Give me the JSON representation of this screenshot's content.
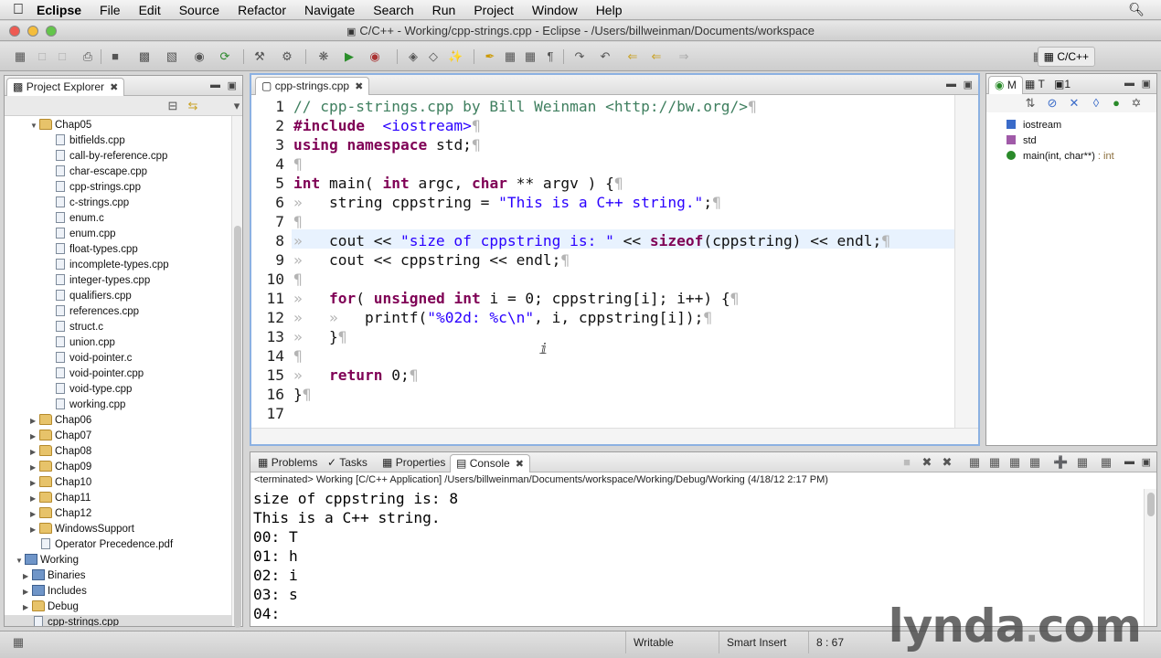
{
  "menubar": {
    "app": "Eclipse",
    "items": [
      "File",
      "Edit",
      "Source",
      "Refactor",
      "Navigate",
      "Search",
      "Run",
      "Project",
      "Window",
      "Help"
    ]
  },
  "window": {
    "title": "C/C++ - Working/cpp-strings.cpp - Eclipse - /Users/billweinman/Documents/workspace"
  },
  "toolbar": {
    "perspective": "C/C++"
  },
  "explorer": {
    "title": "Project Explorer",
    "tree": [
      {
        "label": "Chap05",
        "kind": "folder",
        "indent": 2,
        "expanded": true
      },
      {
        "label": "bitfields.cpp",
        "kind": "file",
        "indent": 4
      },
      {
        "label": "call-by-reference.cpp",
        "kind": "file",
        "indent": 4
      },
      {
        "label": "char-escape.cpp",
        "kind": "file",
        "indent": 4
      },
      {
        "label": "cpp-strings.cpp",
        "kind": "file",
        "indent": 4
      },
      {
        "label": "c-strings.cpp",
        "kind": "file",
        "indent": 4
      },
      {
        "label": "enum.c",
        "kind": "file",
        "indent": 4
      },
      {
        "label": "enum.cpp",
        "kind": "file",
        "indent": 4
      },
      {
        "label": "float-types.cpp",
        "kind": "file",
        "indent": 4
      },
      {
        "label": "incomplete-types.cpp",
        "kind": "file",
        "indent": 4
      },
      {
        "label": "integer-types.cpp",
        "kind": "file",
        "indent": 4
      },
      {
        "label": "qualifiers.cpp",
        "kind": "file",
        "indent": 4
      },
      {
        "label": "references.cpp",
        "kind": "file",
        "indent": 4
      },
      {
        "label": "struct.c",
        "kind": "file",
        "indent": 4
      },
      {
        "label": "union.cpp",
        "kind": "file",
        "indent": 4
      },
      {
        "label": "void-pointer.c",
        "kind": "file",
        "indent": 4
      },
      {
        "label": "void-pointer.cpp",
        "kind": "file",
        "indent": 4
      },
      {
        "label": "void-type.cpp",
        "kind": "file",
        "indent": 4
      },
      {
        "label": "working.cpp",
        "kind": "file",
        "indent": 4
      },
      {
        "label": "Chap06",
        "kind": "folder",
        "indent": 2
      },
      {
        "label": "Chap07",
        "kind": "folder",
        "indent": 2
      },
      {
        "label": "Chap08",
        "kind": "folder",
        "indent": 2
      },
      {
        "label": "Chap09",
        "kind": "folder",
        "indent": 2
      },
      {
        "label": "Chap10",
        "kind": "folder",
        "indent": 2
      },
      {
        "label": "Chap11",
        "kind": "folder",
        "indent": 2
      },
      {
        "label": "Chap12",
        "kind": "folder",
        "indent": 2
      },
      {
        "label": "WindowsSupport",
        "kind": "folder",
        "indent": 2
      },
      {
        "label": "Operator Precedence.pdf",
        "kind": "pdf",
        "indent": 2
      },
      {
        "label": "Working",
        "kind": "project",
        "indent": 0,
        "expanded": true
      },
      {
        "label": "Binaries",
        "kind": "binaries",
        "indent": 1
      },
      {
        "label": "Includes",
        "kind": "includes",
        "indent": 1
      },
      {
        "label": "Debug",
        "kind": "folder",
        "indent": 1
      },
      {
        "label": "cpp-strings.cpp",
        "kind": "file",
        "indent": 1,
        "selected": true
      }
    ]
  },
  "editor": {
    "tab": "cpp-strings.cpp",
    "lines": [
      [
        [
          "cm",
          "// cpp-strings.cpp by Bill Weinman <http://bw.org/>"
        ],
        [
          "ws",
          "¶"
        ]
      ],
      [
        [
          "kw",
          "#include"
        ],
        [
          "",
          "  "
        ],
        [
          "str",
          "<iostream>"
        ],
        [
          "ws",
          "¶"
        ]
      ],
      [
        [
          "kw",
          "using"
        ],
        [
          "",
          " "
        ],
        [
          "kw",
          "namespace"
        ],
        [
          "",
          " std;"
        ],
        [
          "ws",
          "¶"
        ]
      ],
      [
        [
          "ws",
          "¶"
        ]
      ],
      [
        [
          "kw",
          "int"
        ],
        [
          "",
          " main( "
        ],
        [
          "kw",
          "int"
        ],
        [
          "",
          " argc, "
        ],
        [
          "kw",
          "char"
        ],
        [
          "",
          " ** argv ) {"
        ],
        [
          "ws",
          "¶"
        ]
      ],
      [
        [
          "ws",
          "»   "
        ],
        [
          "",
          "string cppstring = "
        ],
        [
          "str",
          "\"This is a C++ string.\""
        ],
        [
          "",
          ";"
        ],
        [
          "ws",
          "¶"
        ]
      ],
      [
        [
          "ws",
          "¶"
        ]
      ],
      [
        [
          "ws",
          "»   "
        ],
        [
          "",
          "cout << "
        ],
        [
          "str",
          "\"size of cppstring is: \""
        ],
        [
          "",
          " << "
        ],
        [
          "kw",
          "sizeof"
        ],
        [
          "",
          "(cppstring) << endl;"
        ],
        [
          "ws",
          "¶"
        ]
      ],
      [
        [
          "ws",
          "»   "
        ],
        [
          "",
          "cout << cppstring << endl;"
        ],
        [
          "ws",
          "¶"
        ]
      ],
      [
        [
          "ws",
          "¶"
        ]
      ],
      [
        [
          "ws",
          "»   "
        ],
        [
          "kw",
          "for"
        ],
        [
          "",
          "( "
        ],
        [
          "kw",
          "unsigned"
        ],
        [
          "",
          " "
        ],
        [
          "kw",
          "int"
        ],
        [
          "",
          " i = 0; cppstring[i]; i++) {"
        ],
        [
          "ws",
          "¶"
        ]
      ],
      [
        [
          "ws",
          "»   »   "
        ],
        [
          "",
          "printf("
        ],
        [
          "str",
          "\"%02d: %c\\n\""
        ],
        [
          "",
          ", i, cppstring[i]);"
        ],
        [
          "ws",
          "¶"
        ]
      ],
      [
        [
          "ws",
          "»   "
        ],
        [
          "",
          "}"
        ],
        [
          "ws",
          "¶"
        ]
      ],
      [
        [
          "ws",
          "¶"
        ]
      ],
      [
        [
          "ws",
          "»   "
        ],
        [
          "kw",
          "return"
        ],
        [
          "",
          " 0;"
        ],
        [
          "ws",
          "¶"
        ]
      ],
      [
        [
          "",
          "}"
        ],
        [
          "ws",
          "¶"
        ]
      ],
      [
        [
          "",
          ""
        ]
      ]
    ]
  },
  "outline": {
    "tabs": [
      "M",
      "T",
      "1"
    ],
    "items": [
      {
        "label": "iostream",
        "hint": ""
      },
      {
        "label": "std",
        "hint": ""
      },
      {
        "label": "main(int, char**)",
        "hint": " : int"
      }
    ]
  },
  "console": {
    "tabs": [
      "Problems",
      "Tasks",
      "Properties",
      "Console"
    ],
    "status": "<terminated> Working [C/C++ Application] /Users/billweinman/Documents/workspace/Working/Debug/Working (4/18/12 2:17 PM)",
    "output": [
      "size of cppstring is: 8",
      "This is a C++ string.",
      "00: T",
      "01: h",
      "02: i",
      "03: s",
      "04: "
    ]
  },
  "statusbar": {
    "writable": "Writable",
    "insert": "Smart Insert",
    "position": "8 : 67"
  },
  "watermark": {
    "name": "lynda",
    "dot": ".",
    "tld": "com"
  },
  "colors": {
    "keyword": "#7f0055",
    "string": "#2a00ff",
    "comment": "#3f7f5f",
    "editor_focus": "#8cb1e2"
  }
}
